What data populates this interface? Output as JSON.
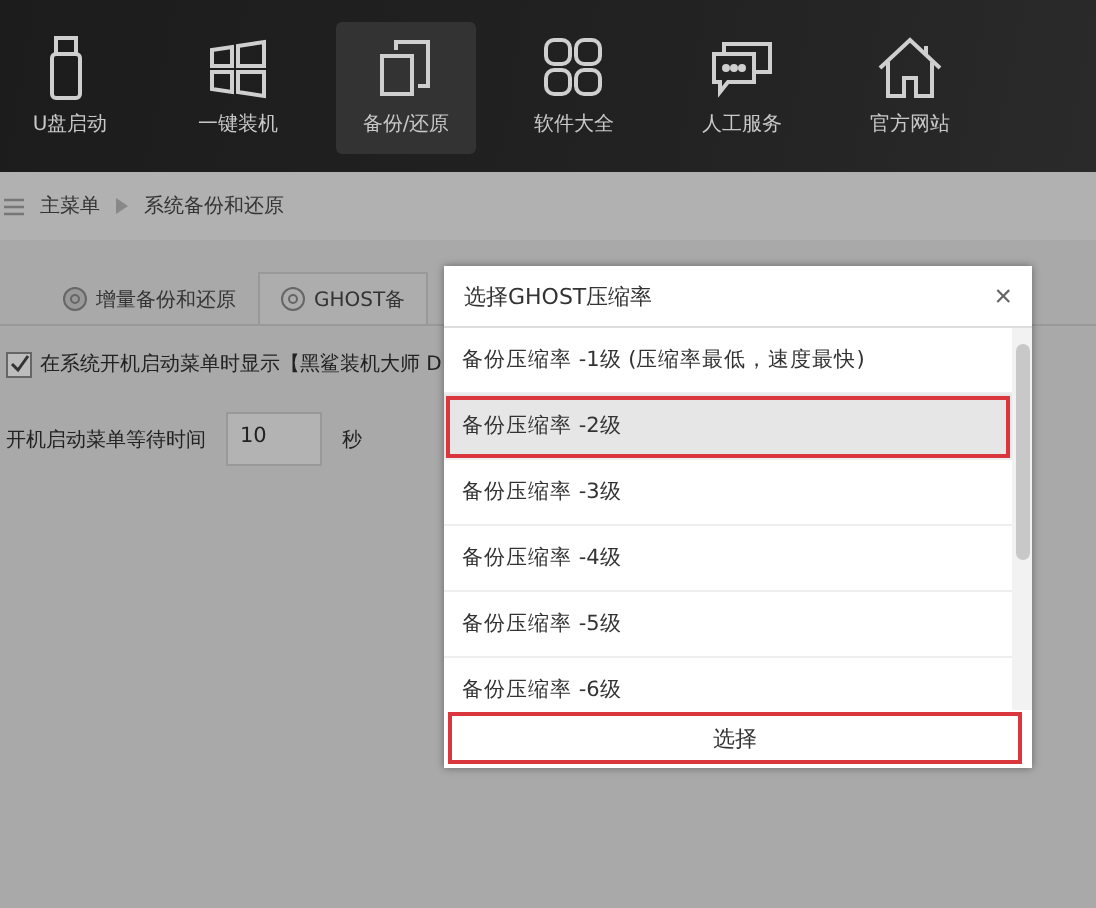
{
  "nav": [
    {
      "label": "U盘启动",
      "selected": false
    },
    {
      "label": "一键装机",
      "selected": false
    },
    {
      "label": "备份/还原",
      "selected": true
    },
    {
      "label": "软件大全",
      "selected": false
    },
    {
      "label": "人工服务",
      "selected": false
    },
    {
      "label": "官方网站",
      "selected": false
    }
  ],
  "breadcrumb": {
    "root": "主菜单",
    "current": "系统备份和还原"
  },
  "tabs": [
    {
      "label": "增量备份和还原",
      "selected": false
    },
    {
      "label": "GHOST备",
      "selected": true
    }
  ],
  "boot_menu_option": {
    "label": "在系统开机启动菜单时显示【黑鲨装机大师 D",
    "checked": true
  },
  "wait_time": {
    "label": "开机启动菜单等待时间",
    "value": "10",
    "unit": "秒"
  },
  "dialog": {
    "title": "选择GHOST压缩率",
    "close": "×",
    "options": [
      {
        "label": "备份压缩率 -1级  (压缩率最低，速度最快)",
        "selected": false
      },
      {
        "label": "备份压缩率 -2级",
        "selected": true
      },
      {
        "label": "备份压缩率 -3级",
        "selected": false
      },
      {
        "label": "备份压缩率 -4级",
        "selected": false
      },
      {
        "label": "备份压缩率 -5级",
        "selected": false
      },
      {
        "label": "备份压缩率 -6级",
        "selected": false
      }
    ],
    "button": {
      "label": "选择",
      "highlighted": true
    }
  }
}
